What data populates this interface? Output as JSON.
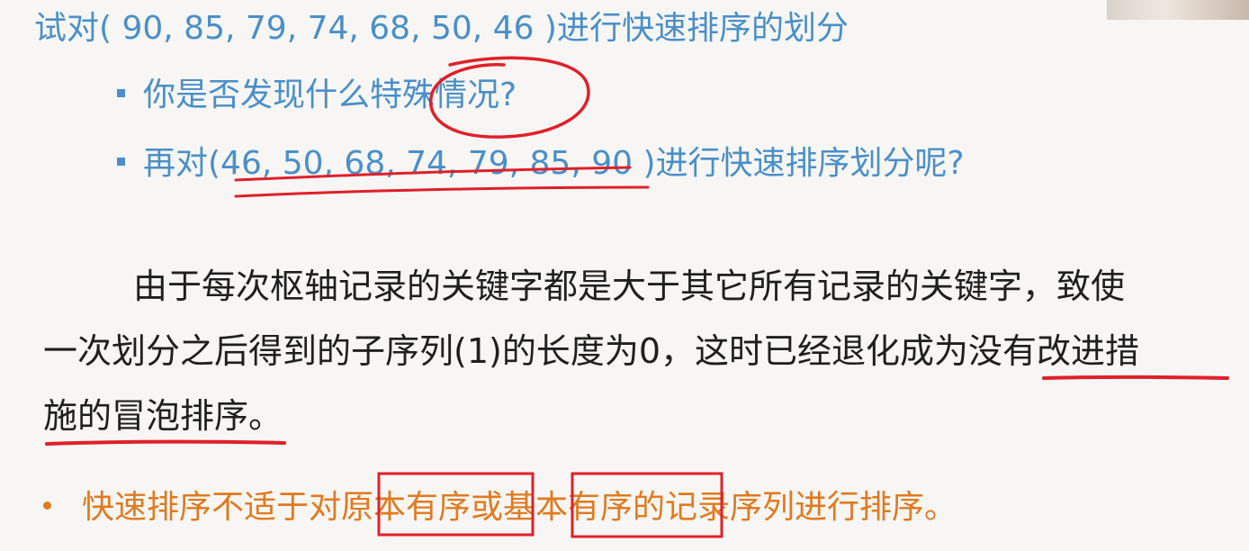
{
  "title": "试对( 90, 85, 79, 74, 68, 50, 46 )进行快速排序的划分",
  "bullets": [
    "你是否发现什么特殊情况?",
    "再对(46, 50, 68, 74, 79, 85, 90 )进行快速排序划分呢?"
  ],
  "paragraph": {
    "line1": "由于每次枢轴记录的关键字都是大于其它所有记录的关键字，致使",
    "line2": "一次划分之后得到的子序列(1)的长度为0，这时已经退化成为没有改进措",
    "line3": "施的冒泡排序。"
  },
  "note": "快速排序不适于对原本有序或基本有序的记录序列进行排序。",
  "colors": {
    "blue_text": "#4a8fc8",
    "orange_text": "#e07a1f",
    "annotation_red": "#e0202a"
  }
}
